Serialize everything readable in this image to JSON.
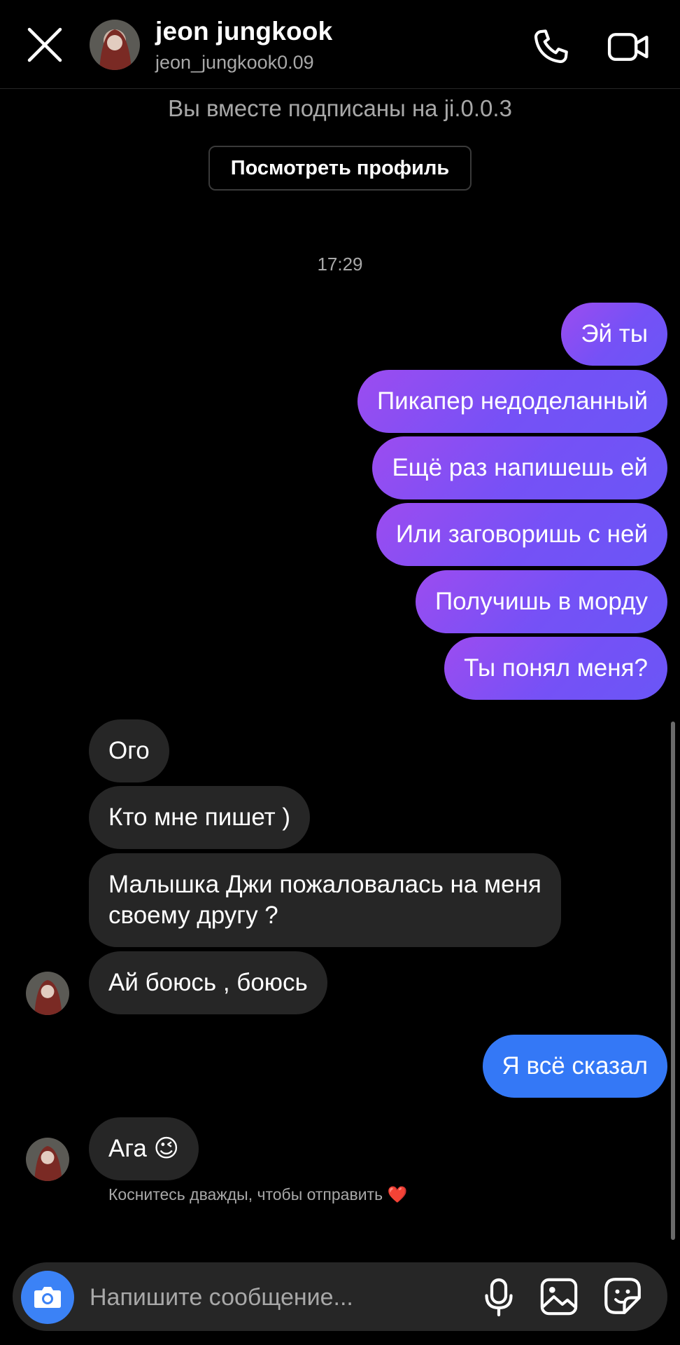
{
  "header": {
    "name": "jeon jungkook",
    "username": "jeon_jungkook0.09"
  },
  "profile": {
    "mutual_follow_text": "Вы вместе подписаны на ji.0.0.3",
    "view_profile_button": "Посмотреть профиль"
  },
  "timestamp": "17:29",
  "messages": [
    {
      "side": "out",
      "text": "Эй ты"
    },
    {
      "side": "out",
      "text": "Пикапер недоделанный"
    },
    {
      "side": "out",
      "text": "Ещё раз напишешь ей"
    },
    {
      "side": "out",
      "text": "Или заговоришь с ней"
    },
    {
      "side": "out",
      "text": "Получишь в морду"
    },
    {
      "side": "out",
      "text": "Ты понял меня?"
    },
    {
      "side": "in",
      "text": "Ого"
    },
    {
      "side": "in",
      "text": "Кто мне пишет )"
    },
    {
      "side": "in",
      "text_line1": "Малышка Джи пожаловалась на меня",
      "text_line2": "своему другу ?"
    },
    {
      "side": "in",
      "text": "Ай боюсь , боюсь"
    },
    {
      "side": "out",
      "text": "Я всё сказал"
    },
    {
      "side": "in",
      "text": "Ага 😉"
    }
  ],
  "double_tap_hint": "Коснитесь дважды, чтобы отправить ❤️",
  "composer": {
    "placeholder": "Напишите сообщение..."
  },
  "icons": {
    "close": "close-icon",
    "call": "phone-icon",
    "video": "video-camera-icon",
    "camera": "camera-icon",
    "mic": "microphone-icon",
    "gallery": "image-icon",
    "sticker": "sticker-icon"
  },
  "colors": {
    "background": "#000000",
    "incoming_bubble": "#262626",
    "outgoing_gradient_start": "#9c4cf0",
    "outgoing_gradient_end": "#6a56f6",
    "last_outgoing": "#3478f6",
    "camera_button": "#3b82f6",
    "secondary_text": "#a8a8a8"
  }
}
